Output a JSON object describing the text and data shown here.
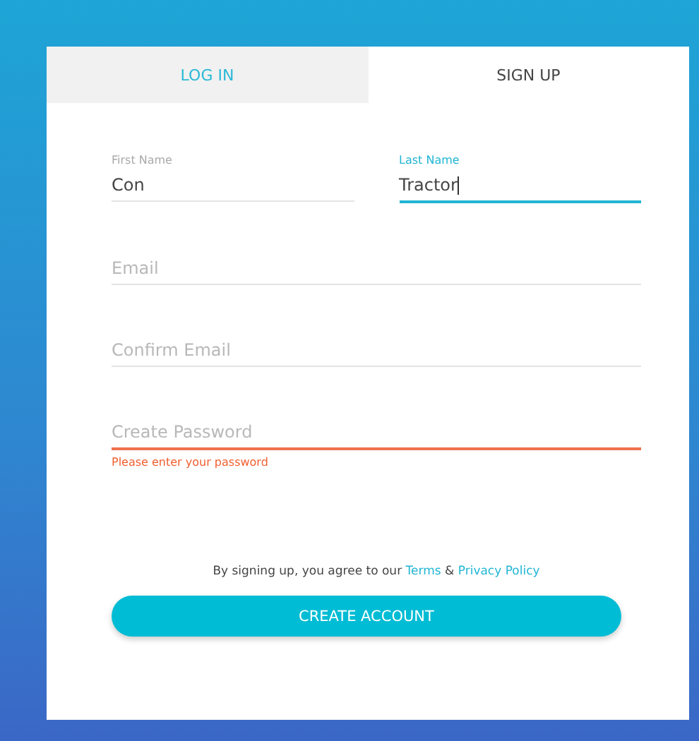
{
  "tabs": [
    {
      "label": "LOG IN",
      "selected": false
    },
    {
      "label": "SIGN UP",
      "selected": true
    }
  ],
  "name_fields": [
    {
      "label": "First Name",
      "value": "Con",
      "focused": false
    },
    {
      "label": "Last Name",
      "value": "Tractor",
      "focused": true
    }
  ],
  "fields": [
    {
      "placeholder": "Email",
      "focused": false
    },
    {
      "placeholder": "Confirm Email",
      "focused": false
    },
    {
      "placeholder": "Create Password",
      "focused": false,
      "error": "Please enter your password"
    }
  ],
  "agreement": {
    "text": "By signing up, you agree to our",
    "links": [
      "Terms",
      "Privacy Policy"
    ],
    "joiner": "&"
  },
  "submit": "CREATE ACCOUNT"
}
